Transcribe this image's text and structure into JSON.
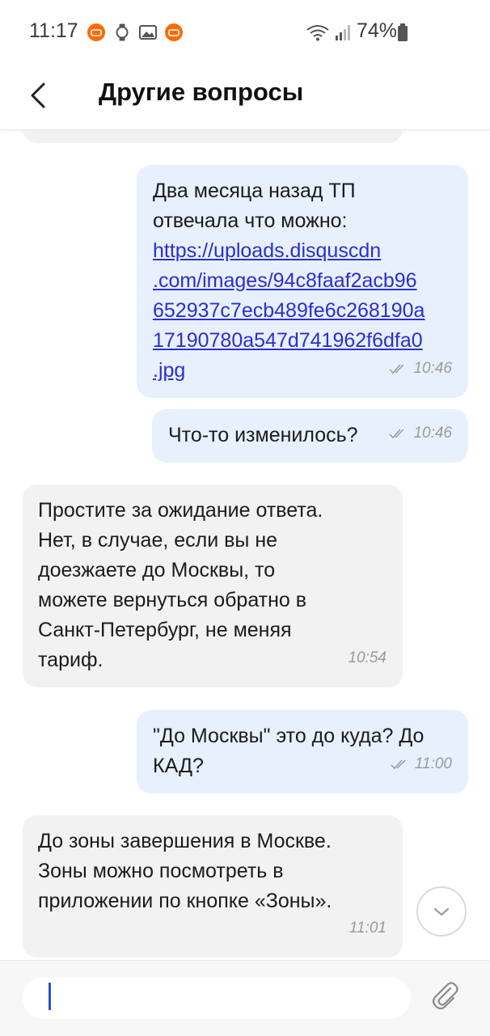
{
  "status_bar": {
    "time": "11:17",
    "battery": "74%",
    "icons": [
      "mi-app-icon",
      "watch-icon",
      "gallery-icon",
      "mi-app-icon",
      "wifi-icon",
      "signal-icon",
      "battery-icon"
    ]
  },
  "header": {
    "title": "Другие вопросы",
    "back_icon": "chevron-left-icon"
  },
  "messages": [
    {
      "direction": "outgoing",
      "text": "Два месяца назад ТП\nотвечала что можно:",
      "link": "https://uploads.disquscdn\n.com/images/94c8faaf2acb96\n652937c7ecb489fe6c268190a\n17190780a547d741962f6dfa0\n.jpg",
      "time": "10:46",
      "status": "read"
    },
    {
      "direction": "outgoing",
      "text": "Что-то изменилось?",
      "time": "10:46",
      "status": "read"
    },
    {
      "direction": "incoming",
      "text": "Простите за ожидание ответа.\nНет, в случае, если вы не\nдоезжаете до Москвы, то\nможете вернуться обратно в\nСанкт-Петербург, не меняя\nтариф.",
      "time": "10:54"
    },
    {
      "direction": "outgoing",
      "text": "\"До Москвы\" это до куда? До\nКАД?",
      "time": "11:00",
      "status": "read"
    },
    {
      "direction": "incoming",
      "text": "До зоны завершения в Москве.\nЗоны можно посмотреть в\nприложении по кнопке «Зоны».",
      "time": "11:01"
    }
  ],
  "composer": {
    "placeholder": "",
    "value": "",
    "attach_icon": "paperclip-icon",
    "scroll_icon": "chevron-down-icon"
  },
  "colors": {
    "outgoing_bubble": "#e8f0fe",
    "incoming_bubble": "#f2f2f2",
    "link": "#2b2fd0",
    "caret": "#2a4fd6"
  }
}
